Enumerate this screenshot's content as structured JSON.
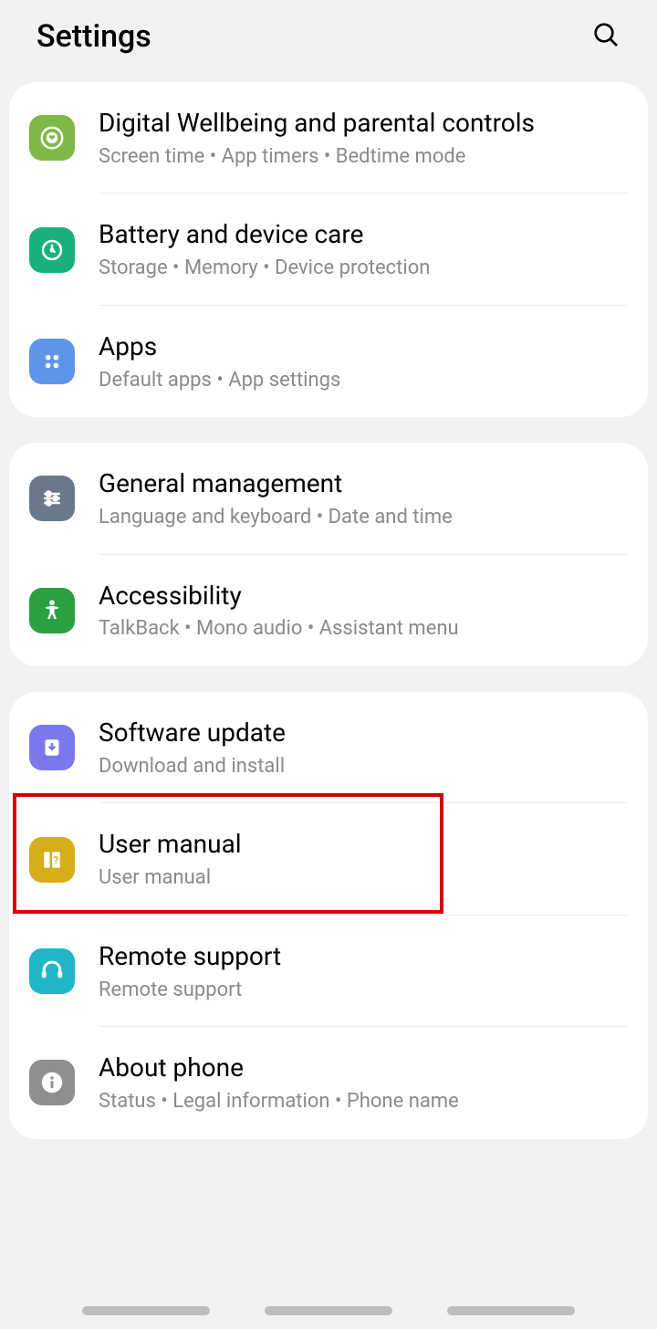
{
  "header": {
    "title": "Settings"
  },
  "groups": [
    {
      "items": [
        {
          "key": "wellbeing",
          "title": "Digital Wellbeing and parental controls",
          "subtitle": "Screen time  •  App timers  •  Bedtime mode"
        },
        {
          "key": "battery",
          "title": "Battery and device care",
          "subtitle": "Storage  •  Memory  •  Device protection"
        },
        {
          "key": "apps",
          "title": "Apps",
          "subtitle": "Default apps  •  App settings"
        }
      ]
    },
    {
      "items": [
        {
          "key": "general",
          "title": "General management",
          "subtitle": "Language and keyboard  •  Date and time"
        },
        {
          "key": "accessibility",
          "title": "Accessibility",
          "subtitle": "TalkBack  •  Mono audio  •  Assistant menu"
        }
      ]
    },
    {
      "items": [
        {
          "key": "software",
          "title": "Software update",
          "subtitle": "Download and install",
          "highlighted": true
        },
        {
          "key": "manual",
          "title": "User manual",
          "subtitle": "User manual"
        },
        {
          "key": "remote",
          "title": "Remote support",
          "subtitle": "Remote support"
        },
        {
          "key": "about",
          "title": "About phone",
          "subtitle": "Status  •  Legal information  •  Phone name"
        }
      ]
    }
  ]
}
